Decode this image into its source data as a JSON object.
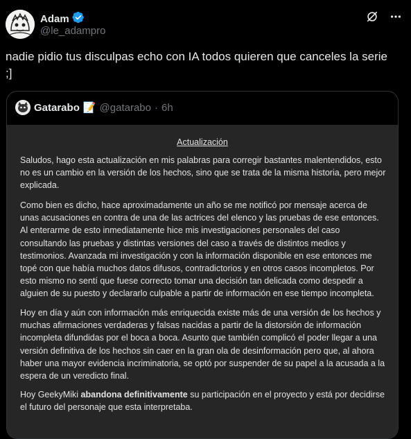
{
  "tweet": {
    "author_name": "Adam",
    "author_handle": "@le_adampro",
    "text": "nadie pidio tus disculpas echo con IA todos quieren que canceles la serie ;]"
  },
  "icons": {
    "verified": "verified-badge-icon",
    "grok": "grok-icon",
    "more": "more-icon"
  },
  "colors": {
    "verified": "#1d9bf0",
    "muted": "#71767b",
    "doc_bg": "#262626"
  },
  "quote": {
    "author_name": "Gatarabo",
    "emoji": "📝",
    "author_handle": "@gatarabo",
    "separator": "·",
    "time": "6h",
    "doc": {
      "title": "Actualización",
      "p1": "Saludos, hago esta actualización en mis palabras para corregir bastantes malentendidos, esto no es un cambio en la versión de los hechos, sino que se trata de la misma historia, pero mejor explicada.",
      "p2": "Como bien es dicho, hace aproximadamente un año se me notificó por mensaje acerca de unas acusaciones en contra de una de las actrices del elenco y las pruebas de ese entonces. Al enterarme de esto inmediatamente hice mis investigaciones personales del caso consultando las pruebas y distintas versiones del caso a través de distintos medios y testimonios. Avanzada mi investigación y con la información disponible en ese entonces me topé con que había muchos datos difusos, contradictorios y en otros casos incompletos. Por esto mismo no sentí que fuese correcto tomar una decisión tan delicada como despedir a alguien de su puesto y declararlo culpable a partir de información en ese tiempo incompleta.",
      "p3": "Hoy en día y aún con información más enriquecida existe más de una versión de los hechos y muchas afirmaciones verdaderas y falsas nacidas a partir de la distorsión de información incompleta difundidas por el boca a boca. Asunto que también complicó el poder llegar a una versión definitiva de los hechos sin caer en la gran ola de desinformación pero que, al ahora haber una mayor evidencia incriminatoria, se optó por suspender de su papel a la acusada a la espera de un veredicto final.",
      "p4_pre": "Hoy GeekyMiki ",
      "p4_bold": "abandona definitivamente",
      "p4_post": " su participación en el proyecto y está por decidirse el futuro del personaje que esta interpretaba."
    }
  }
}
